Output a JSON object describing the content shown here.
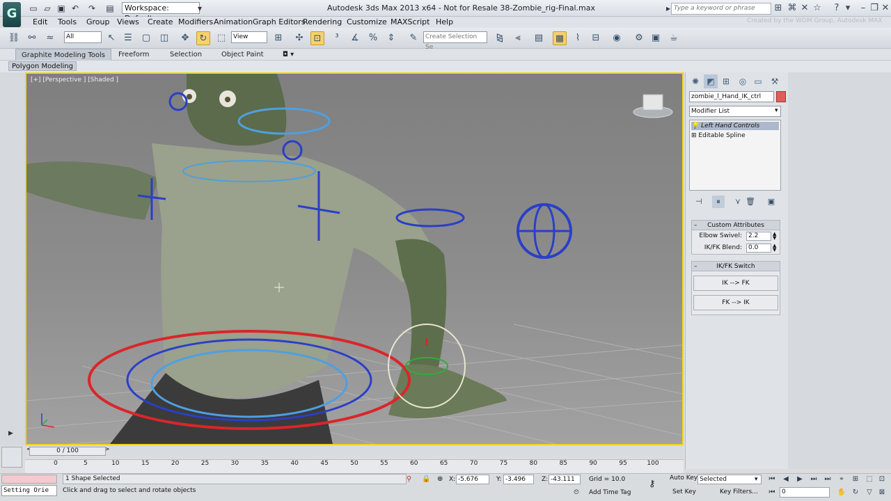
{
  "titlebar": {
    "workspace": "Workspace: Default",
    "title": "Autodesk 3ds Max  2013 x64    - Not for Resale    38-Zombie_rig-Final.max",
    "search_placeholder": "Type a keyword or phrase",
    "watermark": "Created by the WDM Group, Autodesk MAX"
  },
  "menu": [
    "Edit",
    "Tools",
    "Group",
    "Views",
    "Create",
    "Modifiers",
    "Animation",
    "Graph Editors",
    "Rendering",
    "Customize",
    "MAXScript",
    "Help"
  ],
  "toolbar": {
    "filter_value": "All",
    "refcoord_value": "View",
    "named_selection_placeholder": "Create Selection Se"
  },
  "ribbon": {
    "tabs": [
      "Graphite Modeling Tools",
      "Freeform",
      "Selection",
      "Object Paint"
    ],
    "active_tab": "Graphite Modeling Tools",
    "sub_panel": "Polygon Modeling"
  },
  "viewport": {
    "label": "[+] [Perspective ] [Shaded ]"
  },
  "command_panel": {
    "object_name": "zombie_l_Hand_IK_ctrl",
    "object_color": "#e25a5a",
    "modifier_list": "Modifier List",
    "stack": [
      "Left Hand Controls",
      "Editable Spline"
    ],
    "rollouts": {
      "custom_attributes": {
        "title": "Custom Attributes",
        "elbow_swivel_label": "Elbow Swivel:",
        "elbow_swivel_value": "2.2",
        "ikfk_blend_label": "IK/FK Blend:",
        "ikfk_blend_value": "0.0"
      },
      "ikfk_switch": {
        "title": "IK/FK Switch",
        "ik_to_fk": "IK --> FK",
        "fk_to_ik": "FK --> IK"
      }
    }
  },
  "timeline": {
    "slider_label": "0 / 100",
    "ticks": [
      "0",
      "5",
      "10",
      "15",
      "20",
      "25",
      "30",
      "35",
      "40",
      "45",
      "50",
      "55",
      "60",
      "65",
      "70",
      "75",
      "80",
      "85",
      "90",
      "95",
      "100"
    ]
  },
  "status": {
    "maxscript": "Setting Orie",
    "selection": "1 Shape Selected",
    "prompt": "Click and drag to select and rotate objects",
    "x_label": "X:",
    "x_value": "-5.676",
    "y_label": "Y:",
    "y_value": "-3.496",
    "z_label": "Z:",
    "z_value": "-43.111",
    "grid": "Grid = 10.0",
    "add_time_tag": "Add Time Tag",
    "auto_key": "Auto Key",
    "set_key": "Set Key",
    "selected_dd": "Selected",
    "key_filters": "Key Filters...",
    "frame": "0"
  },
  "colors": {
    "viewport_border": "#f2d51f",
    "active_tool": "#f7d16b",
    "ik_ctrl_red": "#d9262b",
    "ctrl_blue": "#2a3fc8",
    "ctrl_light_blue": "#4f9fe0"
  }
}
